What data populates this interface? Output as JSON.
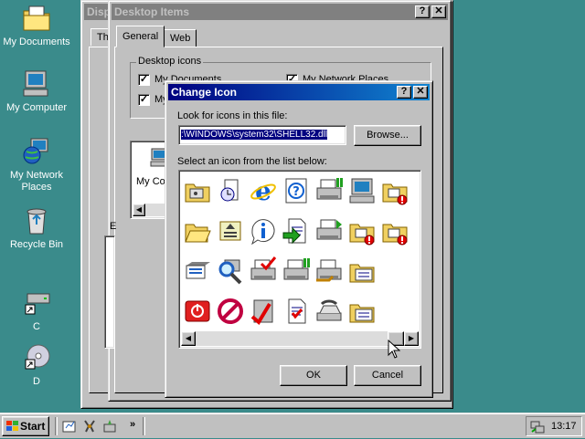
{
  "desktop": {
    "icons": [
      {
        "label": "My Documents"
      },
      {
        "label": "My Computer"
      },
      {
        "label": "My Network Places"
      },
      {
        "label": "Recycle Bin"
      },
      {
        "label": "C"
      },
      {
        "label": "D"
      }
    ]
  },
  "display_window": {
    "title": "Disp",
    "tab_partial": "Th"
  },
  "desktop_items": {
    "title": "Desktop Items",
    "tabs": [
      {
        "label": "General"
      },
      {
        "label": "Web"
      }
    ],
    "group_label": "Desktop icons",
    "checkboxes": [
      {
        "label": "My Documents",
        "checked": true
      },
      {
        "label": "My Network Places",
        "checked": true
      },
      {
        "label": "My Computer",
        "checked": true
      }
    ],
    "preview_label": "My Co",
    "partial_label": "E"
  },
  "change_icon": {
    "title": "Change Icon",
    "file_label": "Look for icons in this file:",
    "file_value": ":\\WINDOWS\\system32\\SHELL32.dll",
    "browse_label": "Browse...",
    "list_label": "Select an icon from the list below:",
    "ok_label": "OK",
    "cancel_label": "Cancel",
    "icons": [
      "folder-settings-icon",
      "clock-document-icon",
      "internet-explorer-icon",
      "help-icon",
      "printer-network-icon",
      "computer-icon",
      "folder-error-icon",
      "folder-open-icon",
      "document-list-icon",
      "info-icon",
      "go-arrow-icon",
      "printer-arrow-icon",
      "folder-error-icon",
      "folder-error-icon",
      "server-list-icon",
      "search-magnifier-icon",
      "printer-check-icon",
      "printer-network-icon",
      "printer-hand-icon",
      "folder-list-icon",
      "",
      "shutdown-icon",
      "no-symbol-icon",
      "pencil-check-icon",
      "document-check-icon",
      "fax-icon",
      "folder-list-icon",
      ""
    ]
  },
  "taskbar": {
    "start_label": "Start",
    "chevron": "»",
    "clock": "13:17"
  },
  "colors": {
    "desktop": "#3a8b8b",
    "titlebar_active": "#000080",
    "face": "#c0c0c0"
  }
}
